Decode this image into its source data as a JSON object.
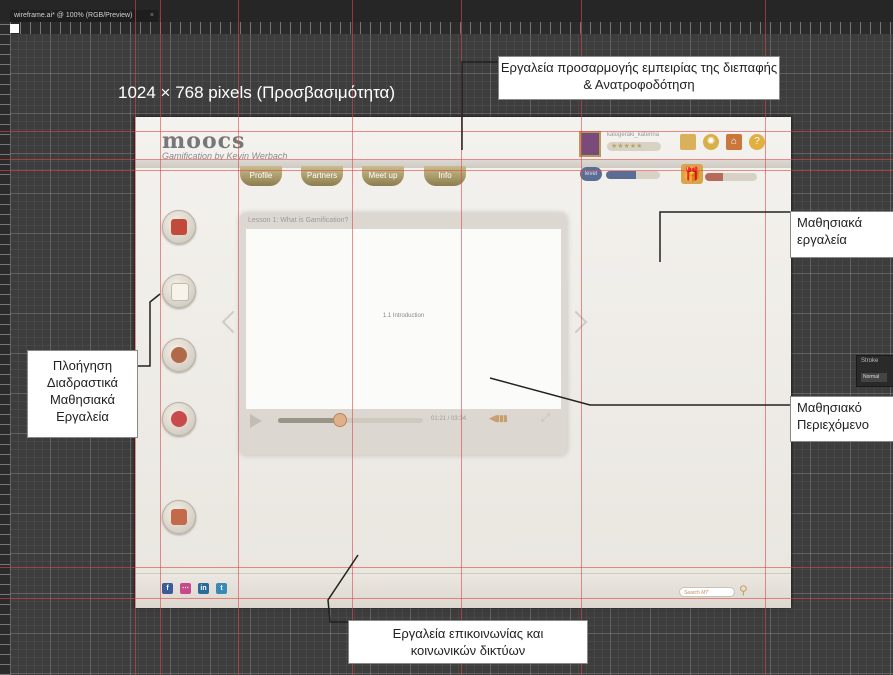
{
  "window": {
    "tab_title": "wireframe.ai* @ 100% (RGB/Preview)",
    "tab_close": "×"
  },
  "artboard": {
    "logo": "moocs",
    "tagline": "Gamification by Kevin Werbach",
    "nav": [
      "Profile",
      "Partners",
      "Meet up",
      "Info"
    ],
    "user": {
      "name": "kalogeraki_katerina",
      "stars": "★★★★★",
      "level_label": "level",
      "xp_progress": 0.55
    },
    "top_icons": [
      "folder-icon",
      "gear-icon",
      "home-icon",
      "help-icon"
    ],
    "help_glyph": "?",
    "gift": {
      "label": "Gifts",
      "progress": 0.35
    },
    "side_icons": [
      "book-icon",
      "notepad-icon",
      "group-icon",
      "pushpin-icon",
      "library-icon"
    ],
    "player": {
      "lesson_title": "Lesson 1: What is Gamification?",
      "video_caption": "1.1 Introduction",
      "time": "01:21 / 03:34",
      "progress": 0.45
    },
    "footer": {
      "social": [
        "f",
        "⋯",
        "in",
        "t"
      ],
      "search_placeholder": "Search MT"
    }
  },
  "annotations": {
    "resolution": "1024 × 768 pixels (Προσβασιμότητα)",
    "ux_tools": "Εργαλεία προσαρμογής εμπειρίας της διεπαφής & Ανατροφοδότηση",
    "learning_tools": "Μαθησιακά εργαλεία",
    "learning_content": "Μαθησιακό Περιεχόμενο",
    "navigation": "Πλοήγηση Διαδραστικά Μαθησιακά Εργαλεία",
    "communication": "Εργαλεία επικοινωνίας και κοινωνικών δικτύων"
  },
  "panel": {
    "title": "Stroke",
    "mode": "Normal"
  },
  "colors": {
    "guide": "#e14646",
    "nav_button": "#a8996a",
    "level_badge": "#5a6d94"
  }
}
